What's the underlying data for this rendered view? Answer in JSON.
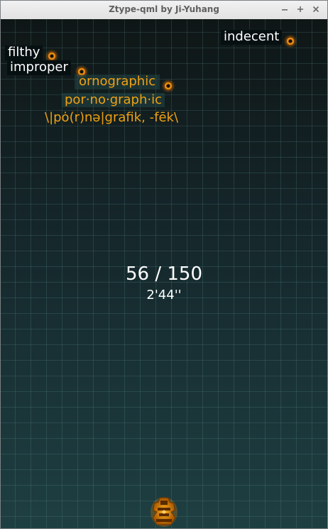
{
  "window": {
    "title": "Ztype-qml by Ji-Yuhang",
    "buttons": {
      "minimize": "–",
      "maximize": "+",
      "close": "×"
    }
  },
  "words": {
    "w1": "indecent",
    "w2": "filthy",
    "w3": "improper",
    "target": "ornographic"
  },
  "definition": {
    "syllables": "por·no·graph·ic",
    "pronunciation": "\\|pȯ(r)nə|grafik, -fēk\\"
  },
  "hud": {
    "score": "56 / 150",
    "time": "2'44''"
  },
  "colors": {
    "target_text": "#f0a210",
    "word_text": "#ffffff",
    "enemy": "#e88a10"
  },
  "icons": {
    "enemy": "enemy-ship-icon",
    "player": "player-ship-icon"
  }
}
